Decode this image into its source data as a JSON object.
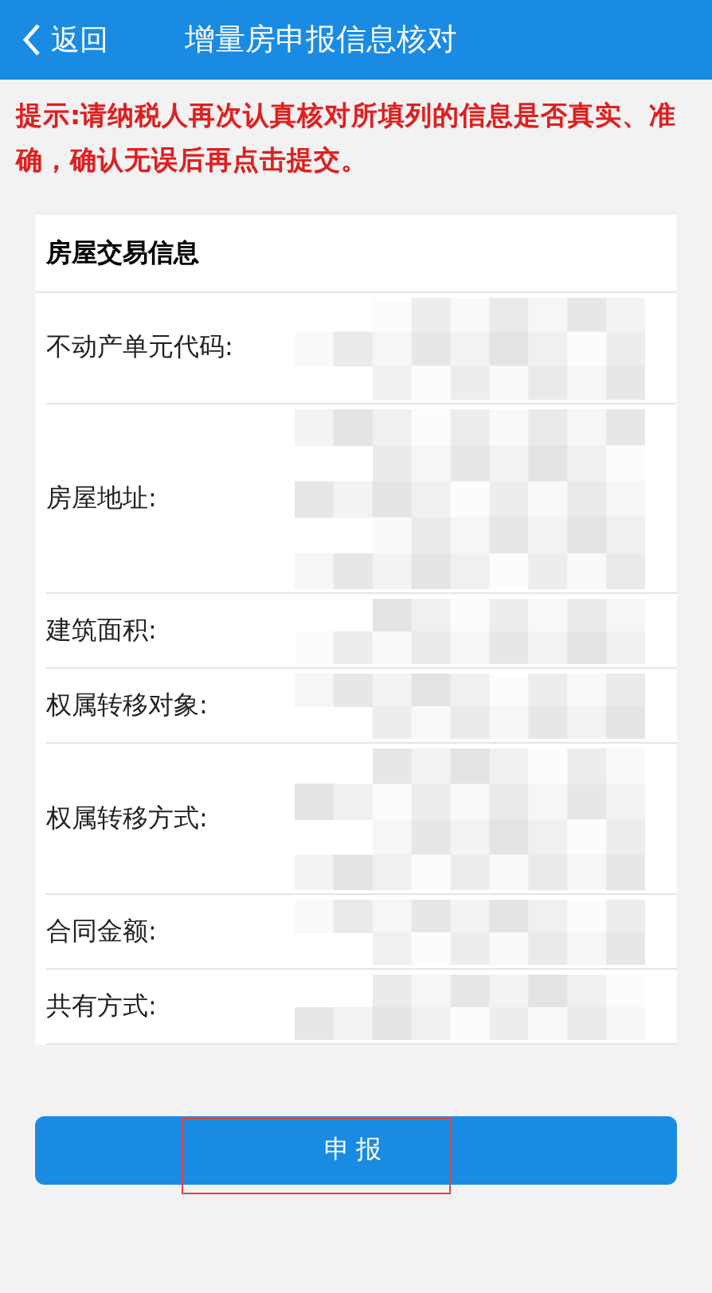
{
  "nav_bar": {
    "back": "返回",
    "title": "增量房申报信息核对"
  },
  "notice": "提示:请纳税人再次认真核对所填列的信息是否真实、准确，确认无误后再点击提交。",
  "card": {
    "title": "房屋交易信息",
    "fields": [
      {
        "label": "不动产单元代码:",
        "kind": "medium",
        "value_hidden": true
      },
      {
        "label": "房屋地址:",
        "kind": "tall",
        "value_hidden": true
      },
      {
        "label": "建筑面积:",
        "kind": "short",
        "value_hidden": true
      },
      {
        "label": "权属转移对象:",
        "kind": "short",
        "value_hidden": true
      },
      {
        "label": "权属转移方式:",
        "kind": "large",
        "value_hidden": true
      },
      {
        "label": "合同金额:",
        "kind": "short",
        "value_hidden": true
      },
      {
        "label": "共有方式:",
        "kind": "short",
        "value_hidden": true
      }
    ]
  },
  "submit_button": {
    "label": "申报",
    "highlighted": true
  }
}
